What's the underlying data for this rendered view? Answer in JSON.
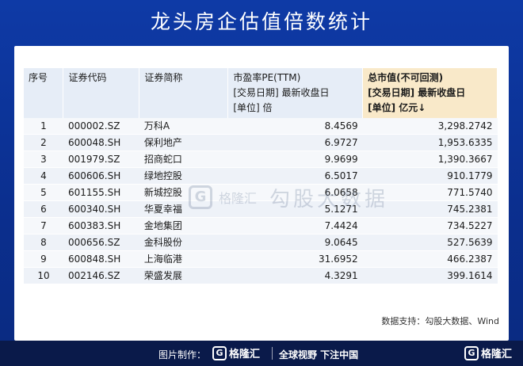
{
  "title": "龙头房企估值倍数统计",
  "table": {
    "headers": {
      "index": "序号",
      "code": "证券代码",
      "name": "证券简称",
      "pe_line1": "市盈率PE(TTM)",
      "pe_line2": "[交易日期] 最新收盘日",
      "pe_line3": "[单位] 倍",
      "cap_line1": "总市值(不可回测)",
      "cap_line2": "[交易日期] 最新收盘日",
      "cap_line3": "[单位] 亿元↓"
    },
    "rows": [
      {
        "index": "1",
        "code": "000002.SZ",
        "name": "万科A",
        "pe": "8.4569",
        "cap": "3,298.2742"
      },
      {
        "index": "2",
        "code": "600048.SH",
        "name": "保利地产",
        "pe": "6.9727",
        "cap": "1,953.6335"
      },
      {
        "index": "3",
        "code": "001979.SZ",
        "name": "招商蛇口",
        "pe": "9.9699",
        "cap": "1,390.3667"
      },
      {
        "index": "4",
        "code": "600606.SH",
        "name": "绿地控股",
        "pe": "6.5017",
        "cap": "910.1779"
      },
      {
        "index": "5",
        "code": "601155.SH",
        "name": "新城控股",
        "pe": "6.0658",
        "cap": "771.5740"
      },
      {
        "index": "6",
        "code": "600340.SH",
        "name": "华夏幸福",
        "pe": "5.1271",
        "cap": "745.2381"
      },
      {
        "index": "7",
        "code": "600383.SH",
        "name": "金地集团",
        "pe": "7.4424",
        "cap": "734.5227"
      },
      {
        "index": "8",
        "code": "000656.SZ",
        "name": "金科股份",
        "pe": "9.0645",
        "cap": "527.5639"
      },
      {
        "index": "9",
        "code": "600848.SH",
        "name": "上海临港",
        "pe": "31.6952",
        "cap": "466.2387"
      },
      {
        "index": "10",
        "code": "002146.SZ",
        "name": "荣盛发展",
        "pe": "4.3291",
        "cap": "399.1614"
      }
    ]
  },
  "watermark": {
    "logo_letter": "G",
    "brand": "格隆汇",
    "text": "勾股大数据"
  },
  "source": "数据支持：勾股大数据、Wind",
  "footer": {
    "made_by": "图片制作：",
    "logo_letter": "G",
    "brand": "格隆汇",
    "slogan": "全球视野 下注中国",
    "right_logo_letter": "G",
    "right_brand": "格隆汇"
  },
  "colors": {
    "background": "#0e3aa6",
    "header_bg": "#e6edf7",
    "highlight_header_bg": "#f9e9c9",
    "footer_bg": "#0a1a4a"
  }
}
